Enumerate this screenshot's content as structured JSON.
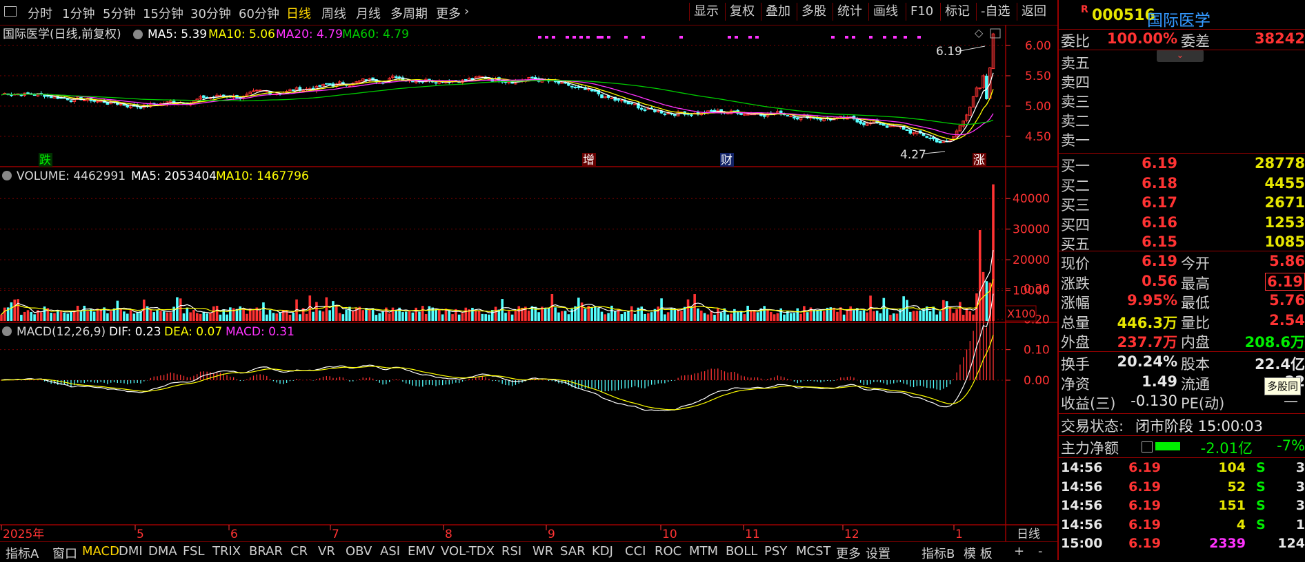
{
  "toolbar": {
    "periods": [
      "分时",
      "1分钟",
      "5分钟",
      "15分钟",
      "30分钟",
      "60分钟",
      "日线",
      "周线",
      "月线",
      "多周期",
      "更多"
    ],
    "active_period": "日线",
    "right_buttons": [
      "显示",
      "复权",
      "叠加",
      "多股",
      "统计",
      "画线",
      "F10",
      "标记",
      "-自选",
      "返回"
    ]
  },
  "main_chart": {
    "title": "国际医学(日线,前复权)",
    "ma5": "MA5: 5.39",
    "ma10": "MA10: 5.06",
    "ma20": "MA20: 4.79",
    "ma60": "MA60: 4.79",
    "y_ticks": [
      "6.00",
      "5.50",
      "5.00",
      "4.50"
    ],
    "high_label": "6.19",
    "low_label": "4.27",
    "markers": [
      {
        "text": "跌",
        "color": "#00aa00"
      },
      {
        "text": "增",
        "color": "#cc0000"
      },
      {
        "text": "财",
        "color": "#2255cc"
      },
      {
        "text": "涨",
        "color": "#cc0000"
      }
    ]
  },
  "volume_chart": {
    "title": "VOLUME: 4462991",
    "ma5": "MA5: 2053404",
    "ma10": "MA10: 1467796",
    "y_ticks": [
      "40000",
      "30000",
      "20000",
      "10000"
    ],
    "unit": "X100"
  },
  "macd_chart": {
    "title": "MACD(12,26,9)",
    "dif": "DIF: 0.23",
    "dea": "DEA: 0.07",
    "macd": "MACD: 0.31",
    "y_ticks": [
      "0.30",
      "0.20",
      "0.10",
      "0.00"
    ]
  },
  "x_axis": {
    "labels": [
      "2025年",
      "5",
      "6",
      "7",
      "8",
      "9",
      "10",
      "11",
      "12",
      "1"
    ],
    "period_label": "日线"
  },
  "bottom_tabs": [
    "指标A",
    "窗口",
    "MACD",
    "DMI",
    "DMA",
    "FSL",
    "TRIX",
    "BRAR",
    "CR",
    "VR",
    "OBV",
    "ASI",
    "EMV",
    "VOL-TDX",
    "RSI",
    "WR",
    "SAR",
    "KDJ",
    "CCI",
    "ROC",
    "MTM",
    "BOLL",
    "PSY",
    "MCST",
    "更多",
    "设置"
  ],
  "bottom_active": "MACD",
  "bottom_right": [
    "指标B",
    "模 板",
    "+",
    "-"
  ],
  "quote": {
    "badge": "R",
    "code": "000516",
    "name": "国际医学",
    "weibi_label": "委比",
    "weibi": "100.00%",
    "weicha_label": "委差",
    "weicha": "38242",
    "sell": [
      "卖五",
      "卖四",
      "卖三",
      "卖二",
      "卖一"
    ],
    "buy": [
      {
        "label": "买一",
        "price": "6.19",
        "vol": "28778"
      },
      {
        "label": "买二",
        "price": "6.18",
        "vol": "4455"
      },
      {
        "label": "买三",
        "price": "6.17",
        "vol": "2671"
      },
      {
        "label": "买四",
        "price": "6.16",
        "vol": "1253"
      },
      {
        "label": "买五",
        "price": "6.15",
        "vol": "1085"
      }
    ],
    "stats": [
      {
        "l1": "现价",
        "v1": "6.19",
        "l2": "今开",
        "v2": "5.86",
        "c1": "red",
        "c2": "red"
      },
      {
        "l1": "涨跌",
        "v1": "0.56",
        "l2": "最高",
        "v2": "6.19",
        "c1": "red",
        "c2": "red"
      },
      {
        "l1": "涨幅",
        "v1": "9.95%",
        "l2": "最低",
        "v2": "5.76",
        "c1": "red",
        "c2": "red"
      },
      {
        "l1": "总量",
        "v1": "446.3万",
        "l2": "量比",
        "v2": "2.54",
        "c1": "yel",
        "c2": "red"
      },
      {
        "l1": "外盘",
        "v1": "237.7万",
        "l2": "内盘",
        "v2": "208.6万",
        "c1": "red",
        "c2": "grn"
      }
    ],
    "finance": [
      {
        "l1": "换手",
        "v1": "20.24%",
        "l2": "股本",
        "v2": "22.4亿"
      },
      {
        "l1": "净资",
        "v1": "1.49",
        "l2": "流通",
        "v2": "22"
      }
    ],
    "pe_label": "收益(三)",
    "pe_value": "-0.130",
    "pe_label2": "PE(动)",
    "pe_value2": "—",
    "tooltip": "多股同",
    "status_label": "交易状态:",
    "status_value": "闭市阶段 15:00:03",
    "flow_label": "主力净额",
    "flow_value": "-2.01亿",
    "flow_pct": "-7%",
    "ticks": [
      {
        "time": "14:56",
        "price": "6.19",
        "vol": "104",
        "side": "S",
        "n": "3"
      },
      {
        "time": "14:56",
        "price": "6.19",
        "vol": "52",
        "side": "S",
        "n": "3"
      },
      {
        "time": "14:56",
        "price": "6.19",
        "vol": "151",
        "side": "S",
        "n": "3"
      },
      {
        "time": "14:56",
        "price": "6.19",
        "vol": "4",
        "side": "S",
        "n": "1"
      },
      {
        "time": "15:00",
        "price": "6.19",
        "vol": "2339",
        "side": "",
        "n": "124"
      }
    ]
  },
  "colors": {
    "up": "#ff3333",
    "down": "#54ffff",
    "ma5": "#ffffff",
    "ma10": "#ffff00",
    "ma20": "#ff33ff",
    "ma60": "#00cc00",
    "grid": "#7a0000"
  }
}
